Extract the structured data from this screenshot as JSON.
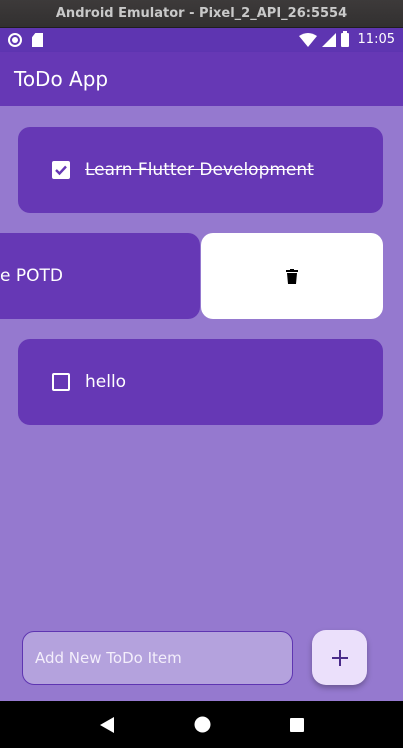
{
  "window": {
    "title": "Android Emulator - Pixel_2_API_26:5554"
  },
  "status_bar": {
    "time": "11:05",
    "icons": [
      "record-icon",
      "sd-card-icon",
      "wifi-icon",
      "cell-signal-icon",
      "battery-icon"
    ]
  },
  "app_bar": {
    "title": "ToDo App"
  },
  "todos": [
    {
      "text": "Learn Flutter Development",
      "done": true
    },
    {
      "text": "e POTD",
      "done": false,
      "swiping": true
    },
    {
      "text": "hello",
      "done": false
    }
  ],
  "swipe_action": {
    "icon": "trash-icon"
  },
  "new_item": {
    "placeholder": "Add New ToDo Item",
    "value": ""
  },
  "add_button": {
    "icon": "plus-icon"
  },
  "nav": {
    "icons": [
      "back-icon",
      "home-icon",
      "recents-icon"
    ]
  },
  "colors": {
    "primary": "#6638b5",
    "background": "#9579cf",
    "fab": "#ebe0fb",
    "input": "#b4a2dd"
  }
}
